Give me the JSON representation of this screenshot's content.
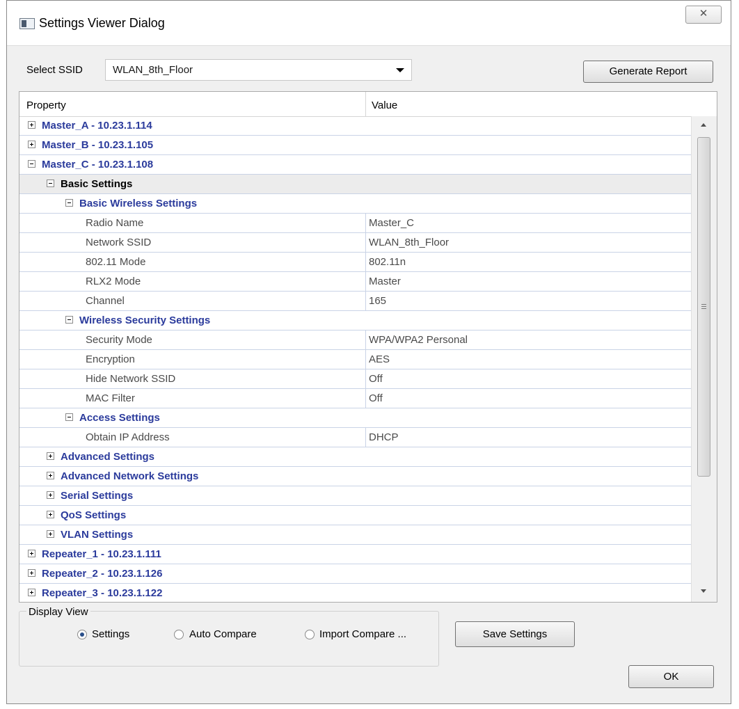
{
  "window": {
    "title": "Settings Viewer Dialog"
  },
  "ssid": {
    "label": "Select SSID",
    "selected": "WLAN_8th_Floor"
  },
  "buttons": {
    "generate_report": "Generate Report",
    "save_settings": "Save Settings",
    "ok": "OK"
  },
  "grid": {
    "headers": {
      "property": "Property",
      "value": "Value"
    },
    "rows": [
      {
        "level": 0,
        "type": "node",
        "expanded": false,
        "name": "Master_A - 10.23.1.114"
      },
      {
        "level": 0,
        "type": "node",
        "expanded": false,
        "name": "Master_B - 10.23.1.105"
      },
      {
        "level": 0,
        "type": "node",
        "expanded": true,
        "name": "Master_C - 10.23.1.108"
      },
      {
        "level": 1,
        "type": "node",
        "expanded": true,
        "name": "Basic Settings",
        "selected": true
      },
      {
        "level": 2,
        "type": "node",
        "expanded": true,
        "name": "Basic Wireless Settings"
      },
      {
        "level": 3,
        "type": "prop",
        "name": "Radio Name",
        "value": "Master_C"
      },
      {
        "level": 3,
        "type": "prop",
        "name": "Network SSID",
        "value": "WLAN_8th_Floor"
      },
      {
        "level": 3,
        "type": "prop",
        "name": "802.11 Mode",
        "value": "802.11n"
      },
      {
        "level": 3,
        "type": "prop",
        "name": "RLX2 Mode",
        "value": "Master"
      },
      {
        "level": 3,
        "type": "prop",
        "name": "Channel",
        "value": "165"
      },
      {
        "level": 2,
        "type": "node",
        "expanded": true,
        "name": "Wireless Security Settings"
      },
      {
        "level": 3,
        "type": "prop",
        "name": "Security Mode",
        "value": "WPA/WPA2 Personal"
      },
      {
        "level": 3,
        "type": "prop",
        "name": "Encryption",
        "value": "AES"
      },
      {
        "level": 3,
        "type": "prop",
        "name": "Hide Network SSID",
        "value": "Off"
      },
      {
        "level": 3,
        "type": "prop",
        "name": "MAC Filter",
        "value": "Off"
      },
      {
        "level": 2,
        "type": "node",
        "expanded": true,
        "name": "Access Settings"
      },
      {
        "level": 3,
        "type": "prop",
        "name": "Obtain IP Address",
        "value": "DHCP"
      },
      {
        "level": 1,
        "type": "node",
        "expanded": false,
        "name": "Advanced Settings"
      },
      {
        "level": 1,
        "type": "node",
        "expanded": false,
        "name": "Advanced Network Settings"
      },
      {
        "level": 1,
        "type": "node",
        "expanded": false,
        "name": "Serial Settings"
      },
      {
        "level": 1,
        "type": "node",
        "expanded": false,
        "name": "QoS Settings"
      },
      {
        "level": 1,
        "type": "node",
        "expanded": false,
        "name": "VLAN Settings"
      },
      {
        "level": 0,
        "type": "node",
        "expanded": false,
        "name": "Repeater_1 - 10.23.1.111"
      },
      {
        "level": 0,
        "type": "node",
        "expanded": false,
        "name": "Repeater_2 - 10.23.1.126"
      },
      {
        "level": 0,
        "type": "node",
        "expanded": false,
        "name": "Repeater_3 - 10.23.1.122"
      }
    ]
  },
  "display_view": {
    "title": "Display View",
    "options": [
      {
        "label": "Settings",
        "checked": true
      },
      {
        "label": "Auto Compare",
        "checked": false
      },
      {
        "label": "Import Compare ...",
        "checked": false
      }
    ]
  },
  "icons": [
    "app-window-icon",
    "close-icon",
    "dropdown-arrow-icon",
    "expand-icon",
    "collapse-icon",
    "scroll-up-icon",
    "scroll-down-icon"
  ]
}
